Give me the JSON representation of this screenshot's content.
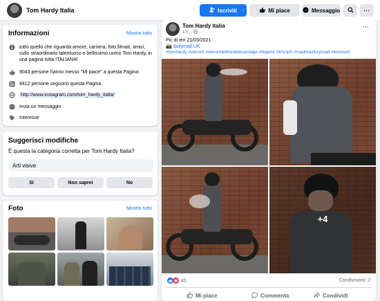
{
  "header": {
    "page_name": "Tom Hardy Italia",
    "follow_label": "Iscriviti",
    "like_label": "Mi piace",
    "message_label": "Messaggio",
    "accent": "#1877f2"
  },
  "info": {
    "title": "Informazioni",
    "show_all": "Mostra tutto",
    "description": "tutto quello che riguarda amore, carriera, foto,filmati, amici, sullo straordinario talentuoso e bellissimo uomo Tom Hardy, in una pagina tutta ITALIANA!",
    "likes": "9043 persone hanno messo \"Mi piace\" a questa Pagina",
    "followers": "9412 persone seguono questa Pagina",
    "website": "http://www.instagram.com/tom_hardy_italia/",
    "message": "Invia un messaggio",
    "category": "Interesse"
  },
  "suggest": {
    "title": "Suggerisci modifiche",
    "question": "È questa la categoria corretta per Tom Hardy Italia?",
    "category_value": "Arti visive",
    "yes": "Sì",
    "unsure": "Non saprei",
    "no": "No"
  },
  "photos": {
    "title": "Foto",
    "show_all": "Mostra tutto"
  },
  "post": {
    "author": "Tom Hardy Italia",
    "time": "1 h",
    "caption": "Pic di ieri 21/03/2021",
    "source": "📸 dailymail.UK",
    "hashtags": "#tomhardy #venom #venomlettherebecarnage #legend #triunph #madmaxfuryroad #bronson",
    "more_photos": "+4",
    "reactions": "45",
    "shares": "Condivisioni: 2",
    "like_action": "Mi piace",
    "comment_action": "Commenta",
    "share_action": "Condividi"
  }
}
